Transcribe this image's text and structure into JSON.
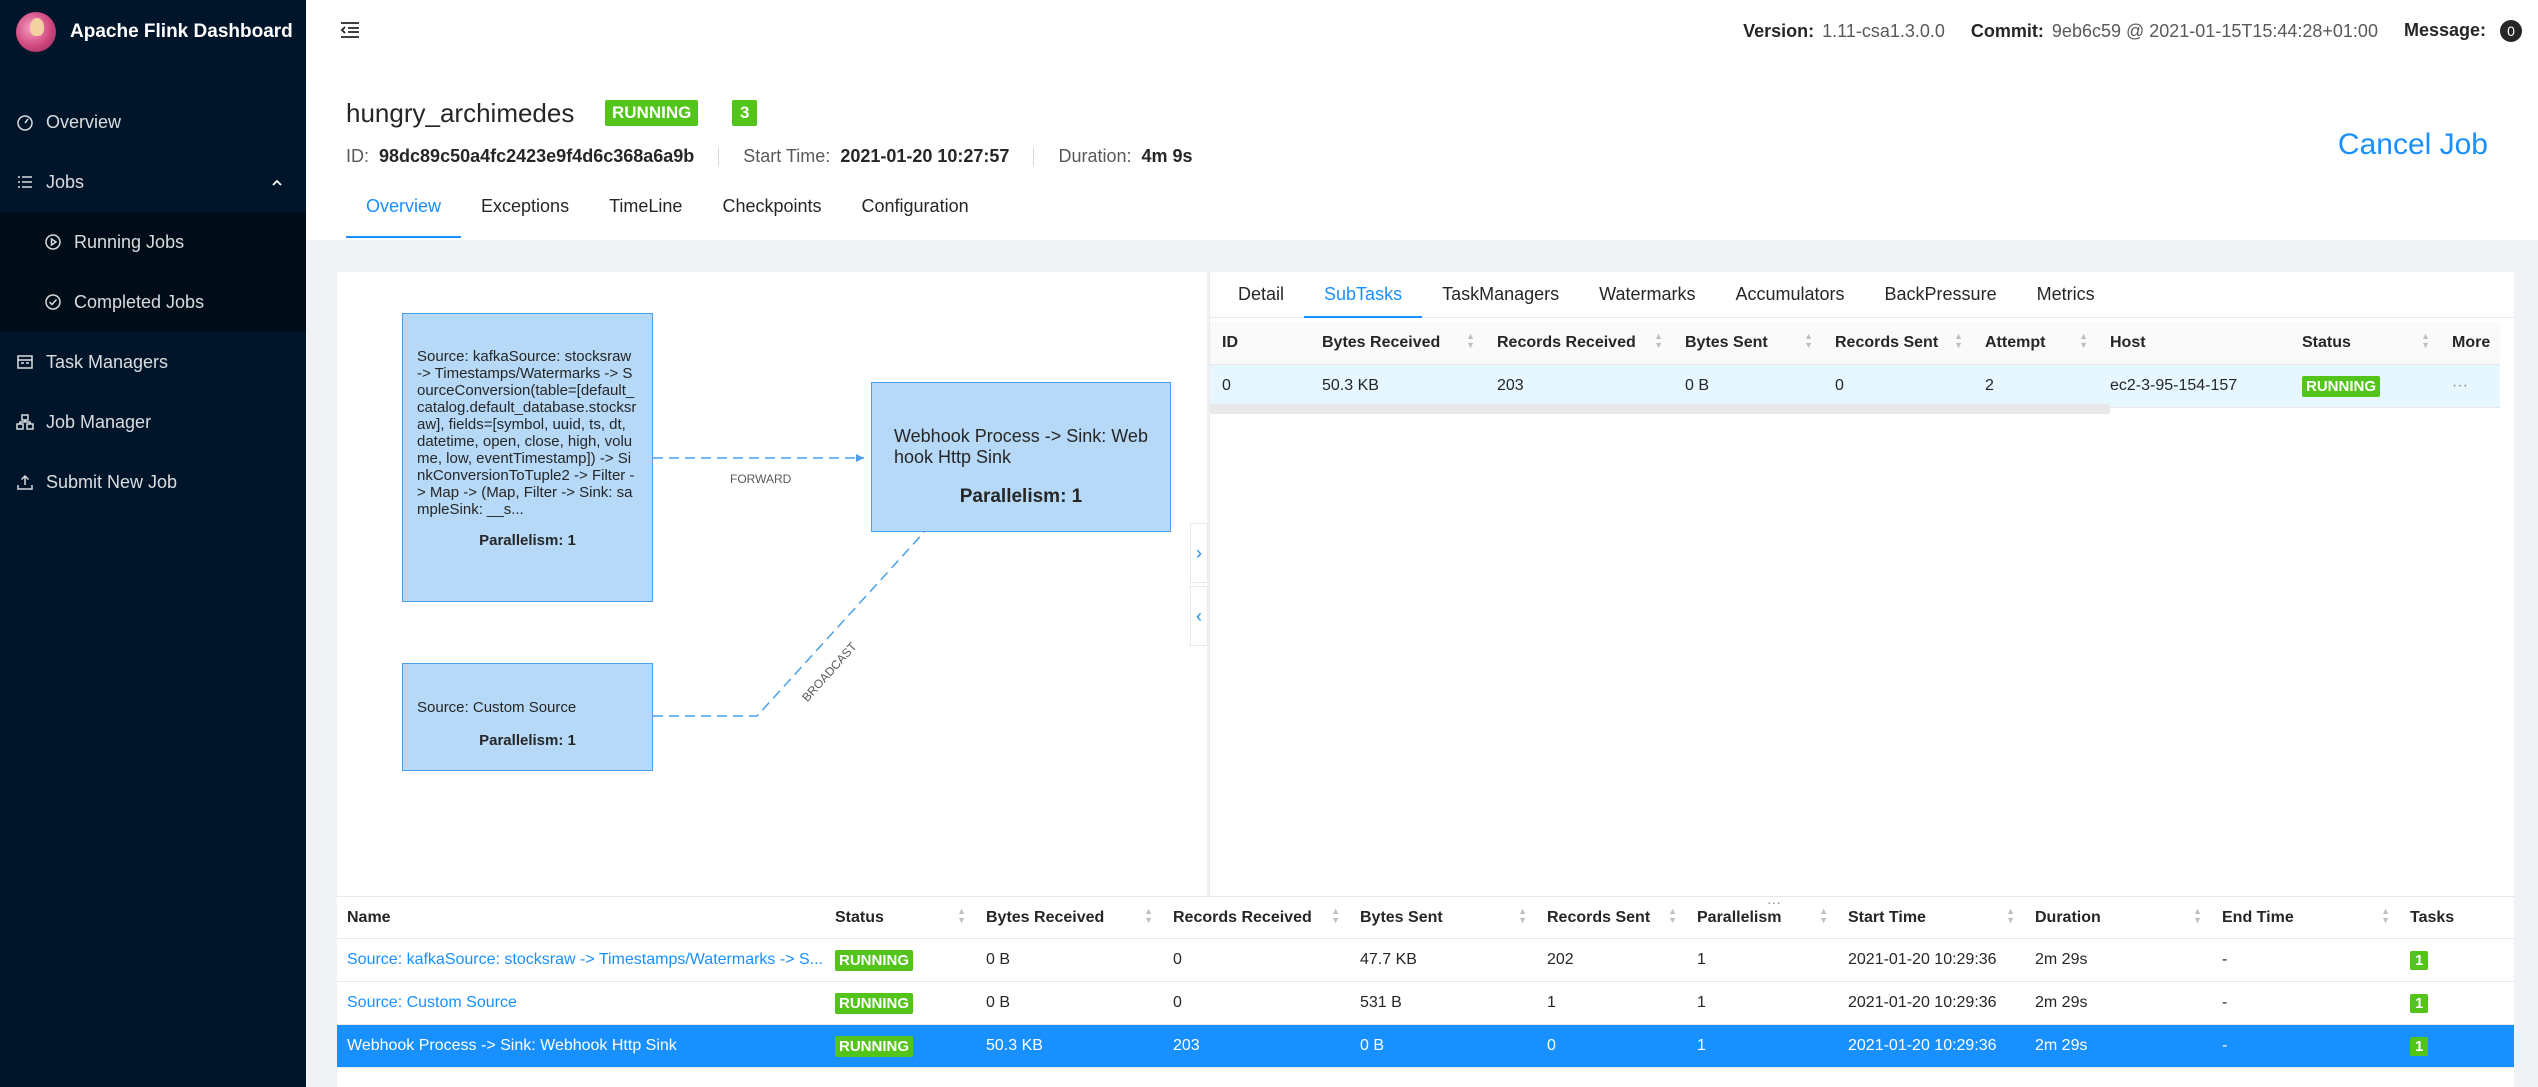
{
  "app": {
    "title": "Apache Flink Dashboard"
  },
  "sidebar": {
    "items": [
      {
        "label": "Overview",
        "icon": "dashboard-icon"
      },
      {
        "label": "Jobs",
        "icon": "list-icon"
      },
      {
        "label": "Running Jobs",
        "icon": "play-circle-icon"
      },
      {
        "label": "Completed Jobs",
        "icon": "check-circle-icon"
      },
      {
        "label": "Task Managers",
        "icon": "schedule-icon"
      },
      {
        "label": "Job Manager",
        "icon": "cluster-icon"
      },
      {
        "label": "Submit New Job",
        "icon": "upload-icon"
      }
    ]
  },
  "header": {
    "version_label": "Version:",
    "version": "1.11-csa1.3.0.0",
    "commit_label": "Commit:",
    "commit": "9eb6c59 @ 2021-01-15T15:44:28+01:00",
    "message_label": "Message:",
    "message_count": "0"
  },
  "job": {
    "name": "hungry_archimedes",
    "status": "RUNNING",
    "task_count": "3",
    "id_label": "ID:",
    "id": "98dc89c50a4fc2423e9f4d6c368a6a9b",
    "start_label": "Start Time:",
    "start": "2021-01-20 10:27:57",
    "duration_label": "Duration:",
    "duration": "4m 9s",
    "cancel_label": "Cancel Job",
    "tabs": [
      "Overview",
      "Exceptions",
      "TimeLine",
      "Checkpoints",
      "Configuration"
    ]
  },
  "graph": {
    "nodes": [
      {
        "text": "Source: kafkaSource: stocksraw -> Timestamps/Watermarks -> SourceConversion(table=[default_catalog.default_database.stocksraw], fields=[symbol, uuid, ts, dt, datetime, open, close, high, volume, low, eventTimestamp]) -> SinkConversionToTuple2 -> Filter -> Map -> (Map, Filter -> Sink: sampleSink: __s...",
        "parallelism": "Parallelism: 1"
      },
      {
        "text": "Source: Custom Source",
        "parallelism": "Parallelism: 1"
      },
      {
        "text": "Webhook Process -> Sink: Webhook Http Sink",
        "parallelism": "Parallelism: 1"
      }
    ],
    "edges": [
      "FORWARD",
      "BROADCAST"
    ]
  },
  "detail": {
    "tabs": [
      "Detail",
      "SubTasks",
      "TaskManagers",
      "Watermarks",
      "Accumulators",
      "BackPressure",
      "Metrics"
    ],
    "columns": [
      "ID",
      "Bytes Received",
      "Records Received",
      "Bytes Sent",
      "Records Sent",
      "Attempt",
      "Host",
      "Status",
      "More"
    ],
    "row": {
      "id": "0",
      "bytes_received": "50.3 KB",
      "records_received": "203",
      "bytes_sent": "0 B",
      "records_sent": "0",
      "attempt": "2",
      "host": "ec2-3-95-154-157",
      "status": "RUNNING",
      "more": "···"
    }
  },
  "vertices": {
    "columns": [
      "Name",
      "Status",
      "Bytes Received",
      "Records Received",
      "Bytes Sent",
      "Records Sent",
      "Parallelism",
      "Start Time",
      "Duration",
      "End Time",
      "Tasks"
    ],
    "rows": [
      {
        "name": "Source: kafkaSource: stocksraw -> Timestamps/Watermarks -> S...",
        "status": "RUNNING",
        "bytes_received": "0 B",
        "records_received": "0",
        "bytes_sent": "47.7 KB",
        "records_sent": "202",
        "parallelism": "1",
        "start": "2021-01-20 10:29:36",
        "duration": "2m 29s",
        "end": "-",
        "tasks": "1"
      },
      {
        "name": "Source: Custom Source",
        "status": "RUNNING",
        "bytes_received": "0 B",
        "records_received": "0",
        "bytes_sent": "531 B",
        "records_sent": "1",
        "parallelism": "1",
        "start": "2021-01-20 10:29:36",
        "duration": "2m 29s",
        "end": "-",
        "tasks": "1"
      },
      {
        "name": "Webhook Process -> Sink: Webhook Http Sink",
        "status": "RUNNING",
        "bytes_received": "50.3 KB",
        "records_received": "203",
        "bytes_sent": "0 B",
        "records_sent": "0",
        "parallelism": "1",
        "start": "2021-01-20 10:29:36",
        "duration": "2m 29s",
        "end": "-",
        "tasks": "1"
      }
    ]
  },
  "colors": {
    "sidebar": "#001529",
    "accent": "#1890ff",
    "running": "#52c41a",
    "node_fill": "#b6d9f7"
  }
}
